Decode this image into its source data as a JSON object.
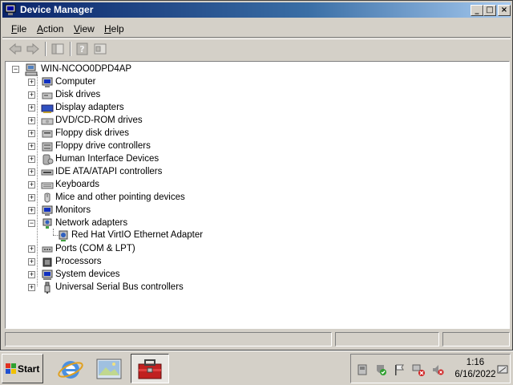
{
  "window": {
    "title": "Device Manager",
    "minimize": "_",
    "maximize": "□",
    "close": "×"
  },
  "menu": {
    "file": {
      "accel": "F",
      "rest": "ile"
    },
    "action": {
      "accel": "A",
      "rest": "ction"
    },
    "view": {
      "accel": "V",
      "rest": "iew"
    },
    "help": {
      "accel": "H",
      "rest": "elp"
    }
  },
  "toolbar": {
    "icons": [
      "back-arrow-icon",
      "forward-arrow-icon",
      "show-hide-tree-icon",
      "help-icon",
      "properties-icon"
    ]
  },
  "tree": {
    "root": {
      "label": "WIN-NCOO0DPD4AP",
      "icon": "computer-icon",
      "expander": "−"
    },
    "categories": [
      {
        "label": "Computer",
        "icon": "monitor-icon",
        "expander": "+"
      },
      {
        "label": "Disk drives",
        "icon": "disk-drive-icon",
        "expander": "+"
      },
      {
        "label": "Display adapters",
        "icon": "display-adapter-icon",
        "expander": "+"
      },
      {
        "label": "DVD/CD-ROM drives",
        "icon": "dvd-drive-icon",
        "expander": "+"
      },
      {
        "label": "Floppy disk drives",
        "icon": "floppy-drive-icon",
        "expander": "+"
      },
      {
        "label": "Floppy drive controllers",
        "icon": "floppy-controller-icon",
        "expander": "+"
      },
      {
        "label": "Human Interface Devices",
        "icon": "hid-icon",
        "expander": "+"
      },
      {
        "label": "IDE ATA/ATAPI controllers",
        "icon": "ide-controller-icon",
        "expander": "+"
      },
      {
        "label": "Keyboards",
        "icon": "keyboard-icon",
        "expander": "+"
      },
      {
        "label": "Mice and other pointing devices",
        "icon": "mouse-icon",
        "expander": "+"
      },
      {
        "label": "Monitors",
        "icon": "monitor-icon",
        "expander": "+"
      },
      {
        "label": "Network adapters",
        "icon": "network-adapter-icon",
        "expander": "−"
      },
      {
        "label": "Ports (COM & LPT)",
        "icon": "port-icon",
        "expander": "+"
      },
      {
        "label": "Processors",
        "icon": "processor-icon",
        "expander": "+"
      },
      {
        "label": "System devices",
        "icon": "system-device-icon",
        "expander": "+"
      },
      {
        "label": "Universal Serial Bus controllers",
        "icon": "usb-icon",
        "expander": "+"
      }
    ],
    "network_child": {
      "label": "Red Hat VirtIO Ethernet Adapter",
      "icon": "network-card-icon"
    }
  },
  "taskbar": {
    "start_label": "Start",
    "quick_launch": [
      "internet-explorer-icon",
      "desktop-icon"
    ],
    "active_task": "device-manager-toolbox-icon",
    "clock_time": "1:16",
    "clock_date": "6/16/2022"
  },
  "colors": {
    "title_start": "#0a246a",
    "title_end": "#a6caf0",
    "face": "#d4d0c8"
  }
}
